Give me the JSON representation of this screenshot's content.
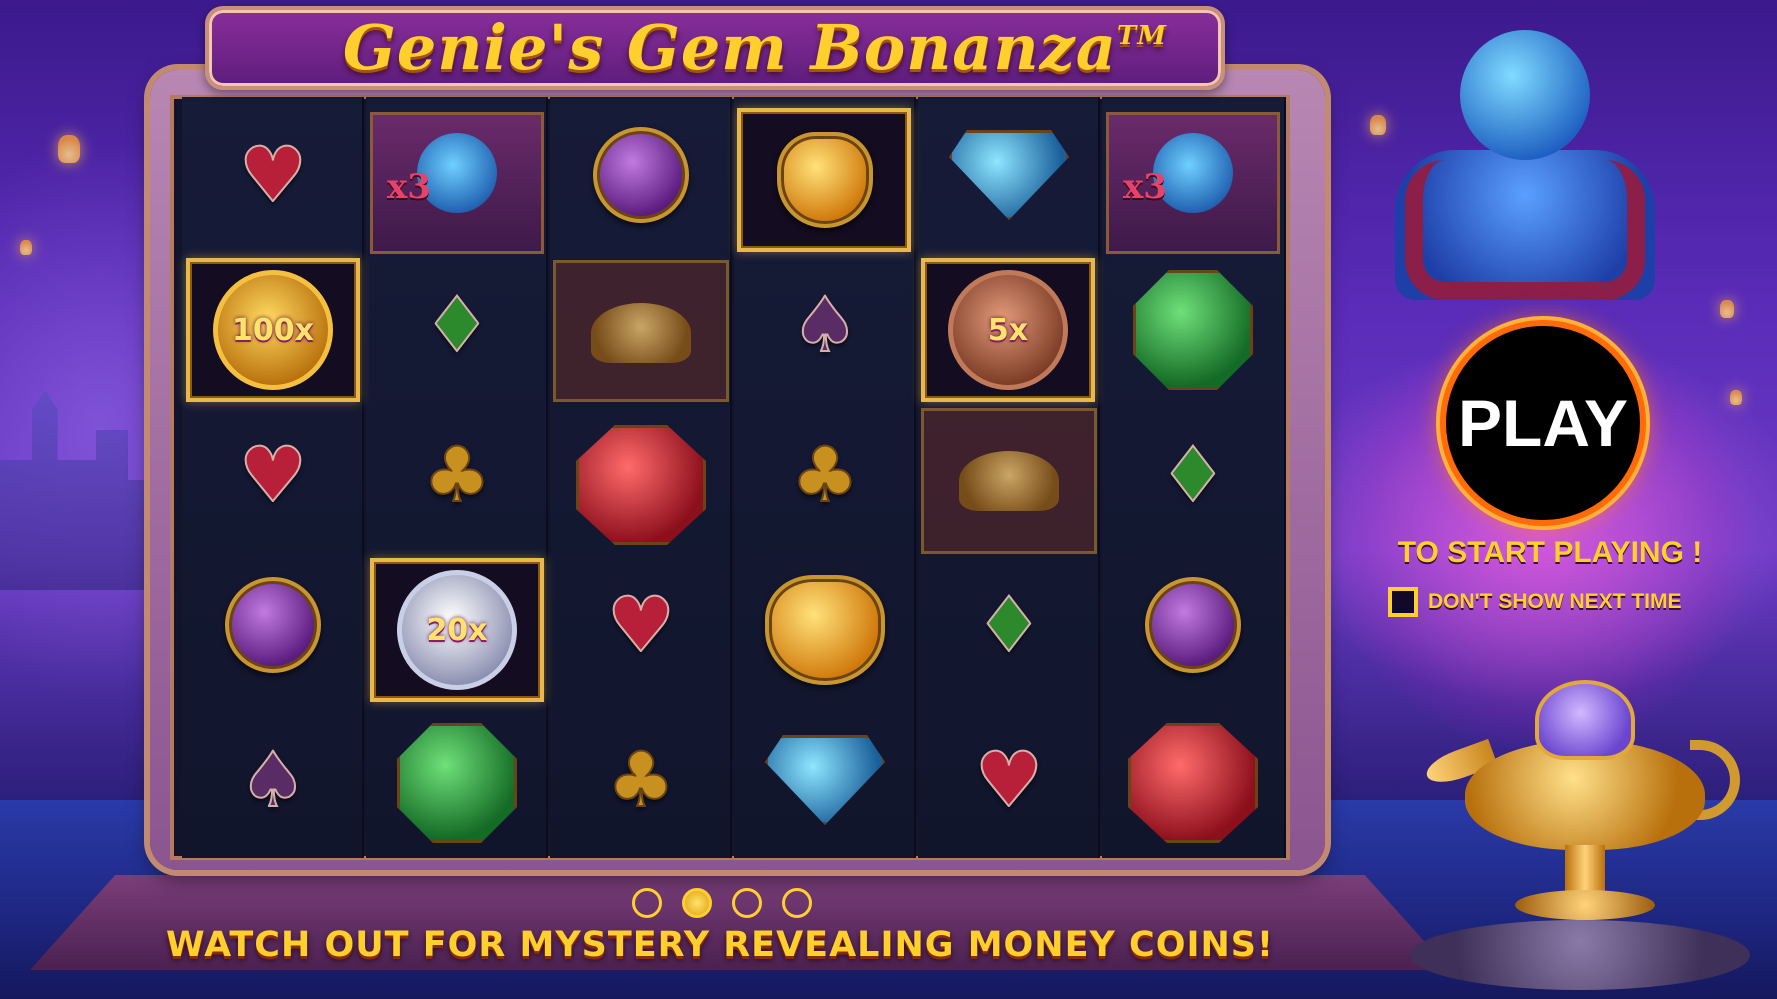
{
  "game": {
    "title": "Genie's Gem Bonanza",
    "trademark": "TM"
  },
  "reels": {
    "columns": 6,
    "rows": 5,
    "symbols": [
      [
        "heart",
        "money-coin",
        "heart",
        "purple-gem",
        "spade"
      ],
      [
        "genie-multiplier",
        "diamond-suit",
        "club",
        "money-coin",
        "green-gem"
      ],
      [
        "purple-gem",
        "magic-lamp",
        "red-gem",
        "heart",
        "club"
      ],
      [
        "yellow-gem",
        "spade",
        "club",
        "yellow-gem",
        "blue-gem"
      ],
      [
        "blue-gem",
        "money-coin",
        "magic-lamp",
        "diamond-suit",
        "heart"
      ],
      [
        "genie-multiplier",
        "green-gem",
        "diamond-suit",
        "purple-gem",
        "red-gem"
      ]
    ],
    "coins": [
      {
        "label": "100x",
        "type": "gold"
      },
      {
        "label": "20x",
        "type": "silver"
      },
      {
        "label": "5x",
        "type": "bronze"
      }
    ],
    "genie_multipliers": [
      "x3",
      "x3"
    ]
  },
  "play_button": {
    "label": "PLAY"
  },
  "prompt": {
    "start_text": "TO START PLAYING !",
    "dont_show_label": "DON'T SHOW NEXT TIME"
  },
  "pagination": {
    "total": 4,
    "current": 2
  },
  "caption": "WATCH OUT FOR MYSTERY REVEALING MONEY COINS!",
  "colors": {
    "accent_gold": "#ffcf2e",
    "play_ring": "#ff6a0a",
    "background": "#5a2bb8"
  }
}
